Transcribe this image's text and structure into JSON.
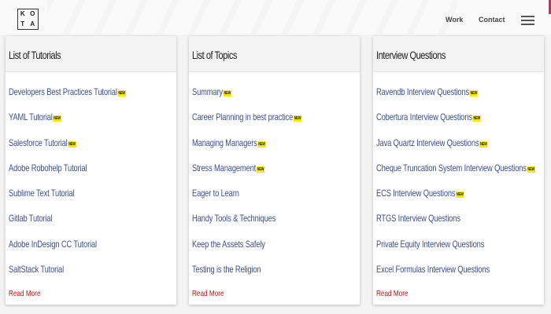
{
  "header": {
    "logo_letters": [
      "K",
      "O",
      "T",
      "A"
    ],
    "nav": {
      "work": "Work",
      "contact": "Contact"
    },
    "menu_icon": "hamburger-icon",
    "accent_color": "#d8266a"
  },
  "cards": [
    {
      "title": "List of Tutorials",
      "items": [
        {
          "label": "Developers Best Practices Tutorial",
          "badge": "NEW"
        },
        {
          "label": "YAML Tutorial",
          "badge": "NEW"
        },
        {
          "label": "Salesforce Tutorial",
          "badge": "NEW"
        },
        {
          "label": "Adobe Robohelp Tutorial",
          "badge": ""
        },
        {
          "label": "Sublime Text Tutorial",
          "badge": ""
        },
        {
          "label": "Gitlab Tutorial",
          "badge": ""
        },
        {
          "label": "Adobe InDesign CC Tutorial",
          "badge": ""
        },
        {
          "label": "SaltStack Tutorial",
          "badge": ""
        }
      ],
      "read_more": "Read More"
    },
    {
      "title": "List of Topics",
      "items": [
        {
          "label": "Summary",
          "badge": "NEW"
        },
        {
          "label": "Career Planning in best practice",
          "badge": "NEW"
        },
        {
          "label": "Managing Managers",
          "badge": "NEW"
        },
        {
          "label": "Stress Management",
          "badge": "NEW"
        },
        {
          "label": "Eager to Learn",
          "badge": ""
        },
        {
          "label": "Handy Tools & Techniques",
          "badge": ""
        },
        {
          "label": "Keep the Assets Safely",
          "badge": ""
        },
        {
          "label": "Testing is the Religion",
          "badge": ""
        }
      ],
      "read_more": "Read More"
    },
    {
      "title": "Interview Questions",
      "items": [
        {
          "label": "Ravendb Interview Questions",
          "badge": "NEW"
        },
        {
          "label": "Cobertura Interview Questions",
          "badge": "NEW"
        },
        {
          "label": "Java Quartz Interview Questions",
          "badge": "NEW"
        },
        {
          "label": "Cheque Truncation System Interview Questions",
          "badge": "NEW"
        },
        {
          "label": "ECS Interview Questions",
          "badge": "NEW"
        },
        {
          "label": "RTGS Interview Questions",
          "badge": ""
        },
        {
          "label": "Private Equity Interview Questions",
          "badge": ""
        },
        {
          "label": "Excel Formulas Interview Questions",
          "badge": ""
        }
      ],
      "read_more": "Read More"
    }
  ],
  "colors": {
    "link": "#3b4e8c",
    "read_more": "#b01313",
    "badge": "#f6e800"
  }
}
